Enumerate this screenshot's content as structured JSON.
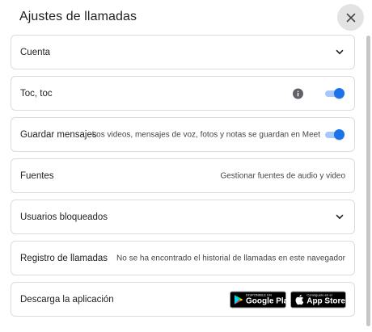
{
  "dialog": {
    "title": "Ajustes de llamadas",
    "close_icon": "close-icon"
  },
  "rows": {
    "cuenta": {
      "label": "Cuenta",
      "icon": "chevron-down-icon"
    },
    "toc": {
      "label": "Toc, toc",
      "info_icon": "info-icon",
      "toggle_on": true
    },
    "guardar": {
      "label": "Guardar mensajes",
      "description": "Los videos, mensajes de voz, fotos y notas se guardan en Meet",
      "toggle_on": true
    },
    "fuentes": {
      "label": "Fuentes",
      "description": "Gestionar fuentes de audio y video"
    },
    "bloqueados": {
      "label": "Usuarios bloqueados",
      "icon": "chevron-down-icon"
    },
    "registro": {
      "label": "Registro de llamadas",
      "description": "No se ha encontrado el historial de llamadas en este navegador"
    },
    "descarga": {
      "label": "Descarga la aplicación",
      "google_play": {
        "small": "DISPONIBLE EN",
        "big": "Google Play"
      },
      "app_store": {
        "small": "Consíguelo en el",
        "big": "App Store"
      }
    }
  },
  "colors": {
    "accent": "#1a73e8",
    "toggle_track": "#a8c7fa",
    "border": "#dadce0",
    "close_bg": "#e3e3e3"
  }
}
